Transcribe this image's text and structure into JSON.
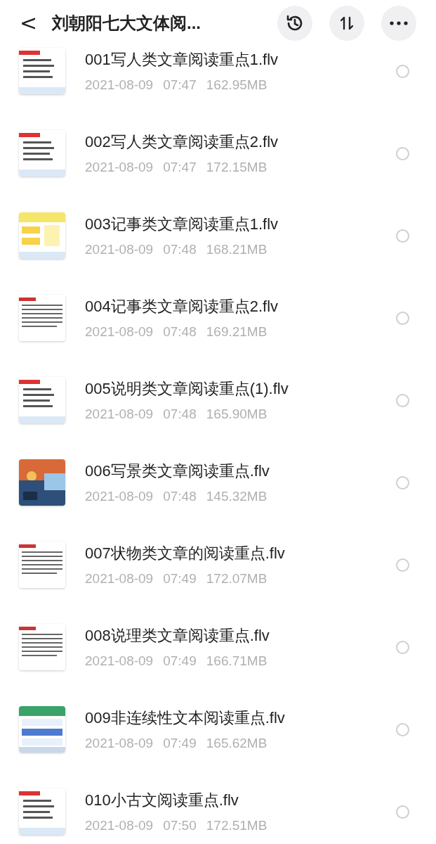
{
  "header": {
    "back": "<",
    "title": "刘朝阳七大文体阅..."
  },
  "files": [
    {
      "name": "001写人类文章阅读重点1.flv",
      "date": "2021-08-09",
      "time": "07:47",
      "size": "162.95MB",
      "selected": false
    },
    {
      "name": "002写人类文章阅读重点2.flv",
      "date": "2021-08-09",
      "time": "07:47",
      "size": "172.15MB",
      "selected": false
    },
    {
      "name": "003记事类文章阅读重点1.flv",
      "date": "2021-08-09",
      "time": "07:48",
      "size": "168.21MB",
      "selected": false
    },
    {
      "name": "004记事类文章阅读重点2.flv",
      "date": "2021-08-09",
      "time": "07:48",
      "size": "169.21MB",
      "selected": false
    },
    {
      "name": "005说明类文章阅读重点(1).flv",
      "date": "2021-08-09",
      "time": "07:48",
      "size": "165.90MB",
      "selected": false
    },
    {
      "name": "006写景类文章阅读重点.flv",
      "date": "2021-08-09",
      "time": "07:48",
      "size": "145.32MB",
      "selected": false
    },
    {
      "name": "007状物类文章的阅读重点.flv",
      "date": "2021-08-09",
      "time": "07:49",
      "size": "172.07MB",
      "selected": false
    },
    {
      "name": "008说理类文章阅读重点.flv",
      "date": "2021-08-09",
      "time": "07:49",
      "size": "166.71MB",
      "selected": false
    },
    {
      "name": "009非连续性文本阅读重点.flv",
      "date": "2021-08-09",
      "time": "07:49",
      "size": "165.62MB",
      "selected": false
    },
    {
      "name": "010小古文阅读重点.flv",
      "date": "2021-08-09",
      "time": "07:50",
      "size": "172.51MB",
      "selected": false
    }
  ]
}
